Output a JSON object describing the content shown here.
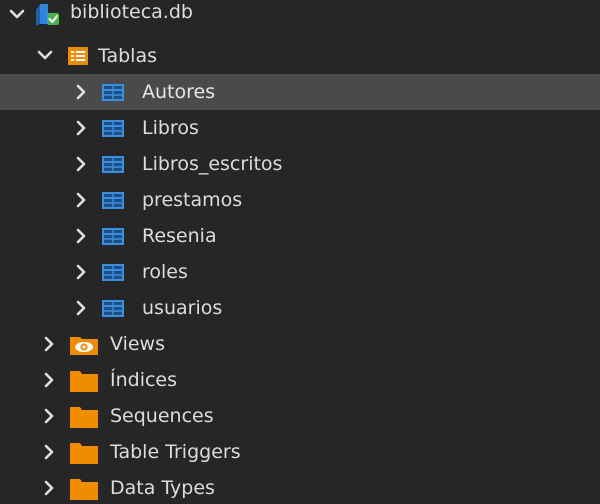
{
  "tree": {
    "database": {
      "label": "biblioteca.db",
      "icon": "database-connected-icon",
      "expanded": true
    },
    "tables_folder": {
      "label": "Tablas",
      "icon": "tables-folder-icon",
      "expanded": true
    },
    "tables": [
      {
        "label": "Autores",
        "selected": true
      },
      {
        "label": "Libros",
        "selected": false
      },
      {
        "label": "Libros_escritos",
        "selected": false
      },
      {
        "label": "prestamos",
        "selected": false
      },
      {
        "label": "Resenia",
        "selected": false
      },
      {
        "label": "roles",
        "selected": false
      },
      {
        "label": "usuarios",
        "selected": false
      }
    ],
    "folders": [
      {
        "label": "Views",
        "icon": "views-folder-icon"
      },
      {
        "label": "Índices",
        "icon": "folder-icon"
      },
      {
        "label": "Sequences",
        "icon": "folder-icon"
      },
      {
        "label": "Table Triggers",
        "icon": "folder-icon"
      },
      {
        "label": "Data Types",
        "icon": "folder-icon"
      }
    ]
  },
  "colors": {
    "background": "#262626",
    "selected_row": "#4a4a4a",
    "text": "#dcdcdc",
    "folder": "#f08c00",
    "table_icon": "#3c8fe0",
    "db_check": "#4caf50"
  }
}
